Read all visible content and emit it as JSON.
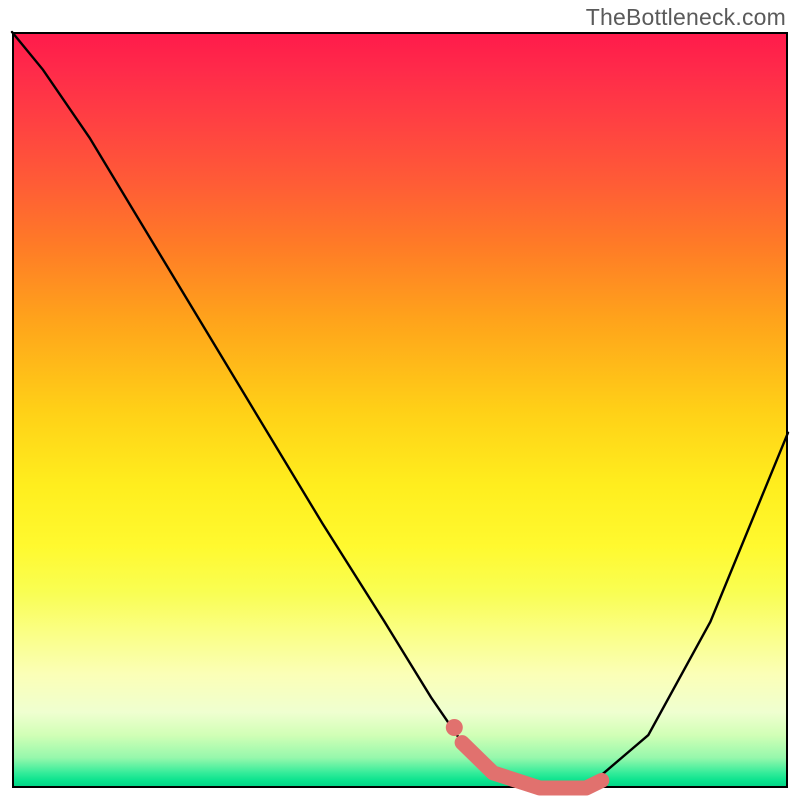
{
  "watermark": "TheBottleneck.com",
  "chart_data": {
    "type": "line",
    "title": "",
    "xlabel": "",
    "ylabel": "",
    "xlim": [
      0,
      100
    ],
    "ylim": [
      0,
      100
    ],
    "grid": false,
    "series": [
      {
        "name": "curve",
        "x": [
          0,
          4,
          10,
          20,
          30,
          40,
          48,
          54,
          58,
          62,
          68,
          74,
          82,
          90,
          100
        ],
        "y": [
          100,
          95,
          86,
          69,
          52,
          35,
          22,
          12,
          6,
          2,
          0,
          0,
          7,
          22,
          47
        ],
        "color": "#000000"
      }
    ],
    "highlight_region": {
      "name": "bottleneck-sweet-spot",
      "color": "#e1716e",
      "x": [
        58,
        62,
        68,
        74,
        76
      ],
      "y": [
        6,
        2,
        0,
        0,
        1
      ]
    },
    "highlight_dot": {
      "x": 57,
      "y": 8
    },
    "background_gradient": {
      "top": "#ff1a4b",
      "mid": "#ffee1e",
      "bottom": "#00d184"
    }
  }
}
